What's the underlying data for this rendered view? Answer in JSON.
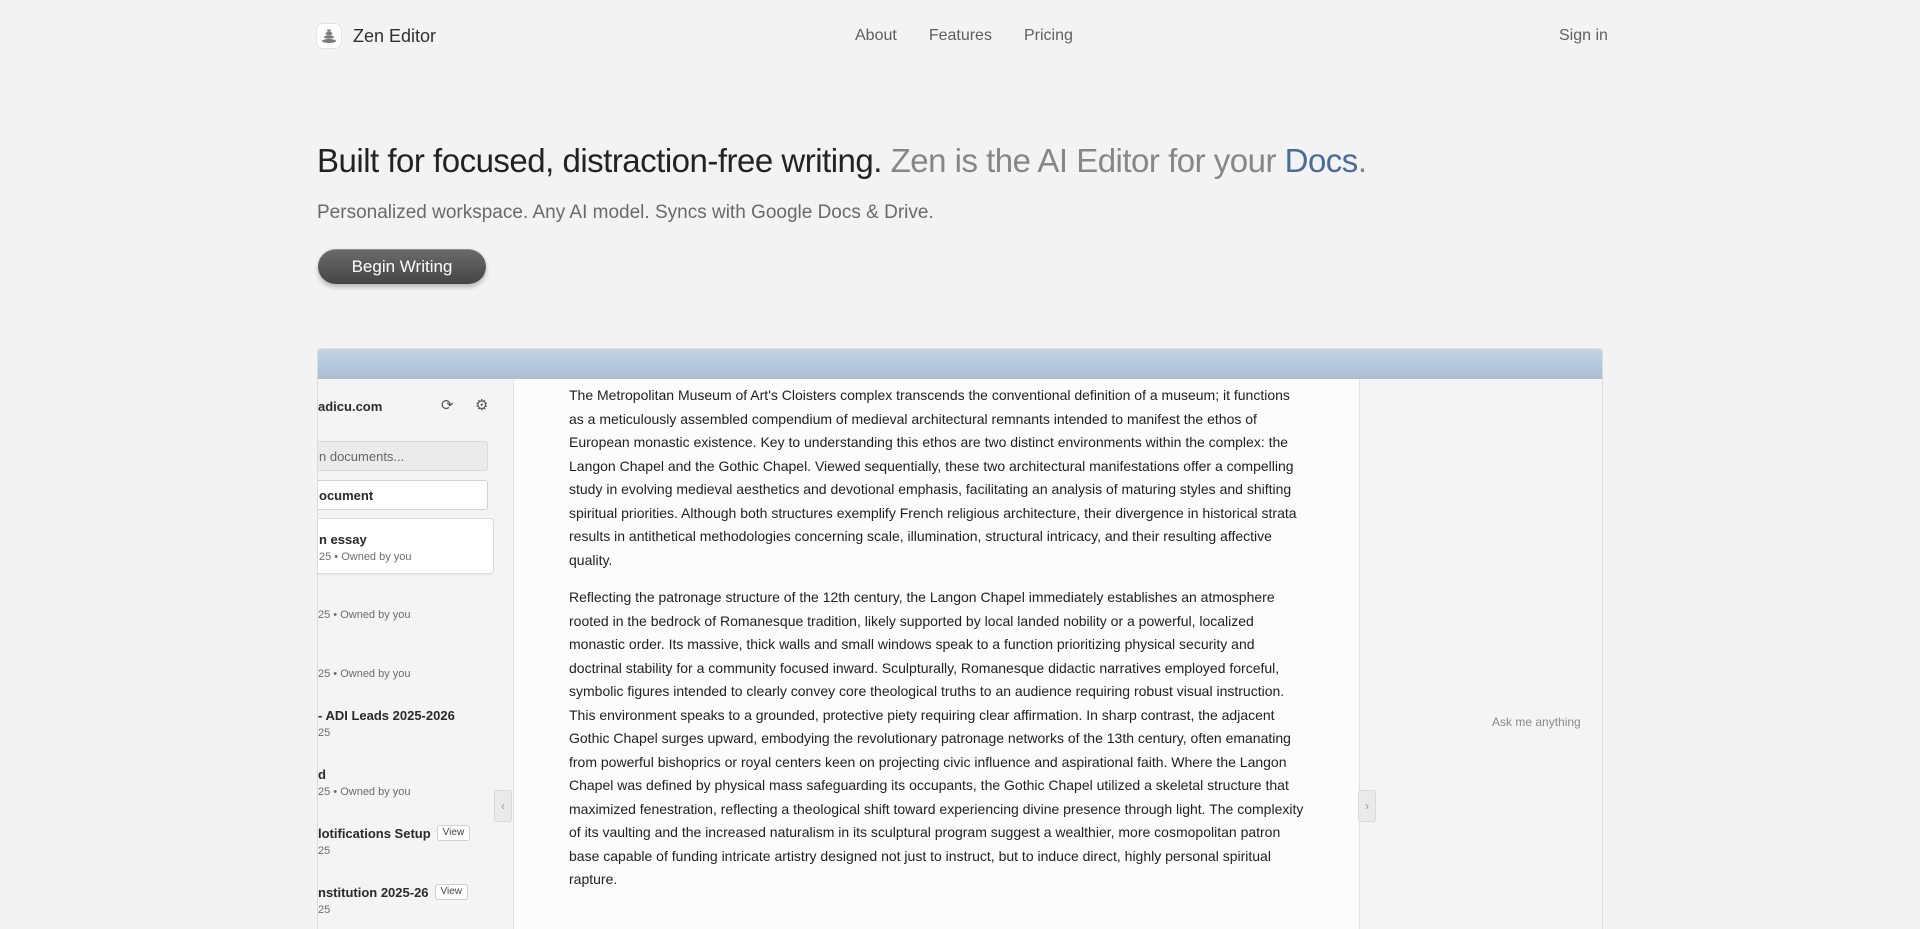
{
  "header": {
    "brand_name": "Zen Editor",
    "logo_icon": "zen-stones-icon",
    "nav": [
      "About",
      "Features",
      "Pricing"
    ],
    "sign_in": "Sign in"
  },
  "hero": {
    "headline_main": "Built for focused, distraction-free writing.",
    "headline_muted": "Zen is the AI Editor for your",
    "headline_accent": "Docs",
    "headline_end": ".",
    "subline": "Personalized workspace. Any AI model. Syncs with Google Docs & Drive.",
    "cta": "Begin Writing",
    "accent_color": "#4a6b9b"
  },
  "preview": {
    "sidebar": {
      "account": "adicu.com",
      "refresh_icon": "refresh-icon",
      "settings_icon": "gear-icon",
      "search_placeholder": "n documents...",
      "new_document": "ocument",
      "documents": [
        {
          "title": "n essay",
          "meta": "25 • Owned by you",
          "badge": ""
        },
        {
          "title": "",
          "meta": "25 • Owned by you",
          "badge": ""
        },
        {
          "title": "",
          "meta": "25 • Owned by you",
          "badge": ""
        },
        {
          "title": "- ADI Leads 2025-2026",
          "meta": "25",
          "badge": ""
        },
        {
          "title": "d",
          "meta": "25 • Owned by you",
          "badge": ""
        },
        {
          "title": "lotifications Setup",
          "meta": "25",
          "badge": "View"
        },
        {
          "title": "nstitution 2025-26",
          "meta": "25",
          "badge": "View"
        }
      ]
    },
    "editor": {
      "paragraphs": [
        "The Metropolitan Museum of Art's Cloisters complex transcends the conventional definition of a museum; it functions as a meticulously assembled compendium of medieval architectural remnants intended to manifest the ethos of European monastic existence. Key to understanding this ethos are two distinct environments within the complex: the Langon Chapel and the Gothic Chapel. Viewed sequentially, these two architectural manifestations offer a compelling study in evolving medieval aesthetics and devotional emphasis, facilitating an analysis of maturing styles and shifting spiritual priorities. Although both structures exemplify French religious architecture, their divergence in historical strata results in antithetical methodologies concerning scale, illumination, structural intricacy, and their resulting affective quality.",
        "Reflecting the patronage structure of the 12th century, the Langon Chapel immediately establishes an atmosphere rooted in the bedrock of Romanesque tradition, likely supported by local landed nobility or a powerful, localized monastic order. Its massive, thick walls and small windows speak to a function prioritizing physical security and doctrinal stability for a community focused inward. Sculpturally, Romanesque didactic narratives employed forceful, symbolic figures intended to clearly convey core theological truths to an audience requiring robust visual instruction. This environment speaks to a grounded, protective piety requiring clear affirmation. In sharp contrast, the adjacent Gothic Chapel surges upward, embodying the revolutionary patronage networks of the 13th century, often emanating from powerful bishoprics or royal centers keen on projecting civic influence and aspirational faith. Where the Langon Chapel was defined by physical mass safeguarding its occupants, the Gothic Chapel utilized a skeletal structure that maximized fenestration, reflecting a theological shift toward experiencing divine presence through light. The complexity of its vaulting and the increased naturalism in its sculptural program suggest a wealthier, more cosmopolitan patron base capable of funding intricate artistry designed not just to instruct, but to induce direct, highly personal spiritual rapture."
      ]
    },
    "collapse_left": "‹",
    "collapse_right": "›",
    "assistant_placeholder": "Ask me anything"
  }
}
